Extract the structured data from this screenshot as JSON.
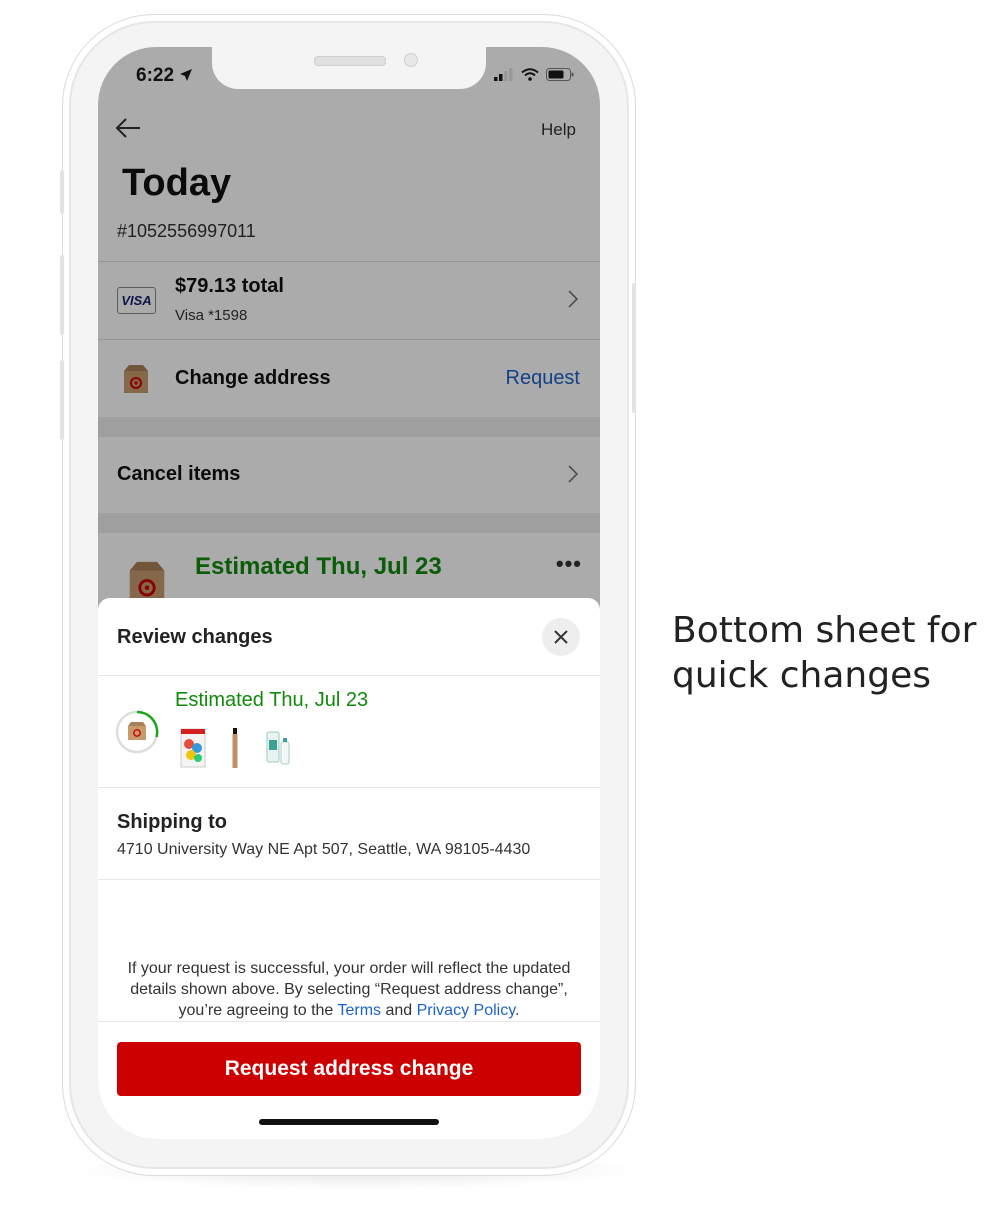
{
  "status_bar": {
    "time": "6:22"
  },
  "header": {
    "help_label": "Help",
    "title": "Today",
    "order_number": "#1052556997011"
  },
  "payment": {
    "card_brand": "VISA",
    "total": "$79.13 total",
    "card": "Visa *1598"
  },
  "address_row": {
    "label": "Change address",
    "action": "Request"
  },
  "cancel_row": {
    "label": "Cancel items"
  },
  "delivery": {
    "estimate": "Estimated Thu, Jul 23"
  },
  "sheet": {
    "title": "Review changes",
    "estimate": "Estimated Thu, Jul 23",
    "shipping_label": "Shipping to",
    "shipping_address": "4710 University Way NE Apt 507, Seattle, WA 98105-4430",
    "disclaimer_part1": "If your request is successful, your order will reflect the updated details shown above. By selecting “Request address change”, you’re agreeing to the ",
    "terms_link": "Terms",
    "disclaimer_and": " and ",
    "privacy_link": "Privacy Policy",
    "disclaimer_end": ".",
    "cta_label": "Request address change"
  },
  "caption": "Bottom sheet for quick changes",
  "colors": {
    "brand_red": "#cc0000",
    "green": "#118a0c",
    "link_blue": "#1b63c9"
  }
}
